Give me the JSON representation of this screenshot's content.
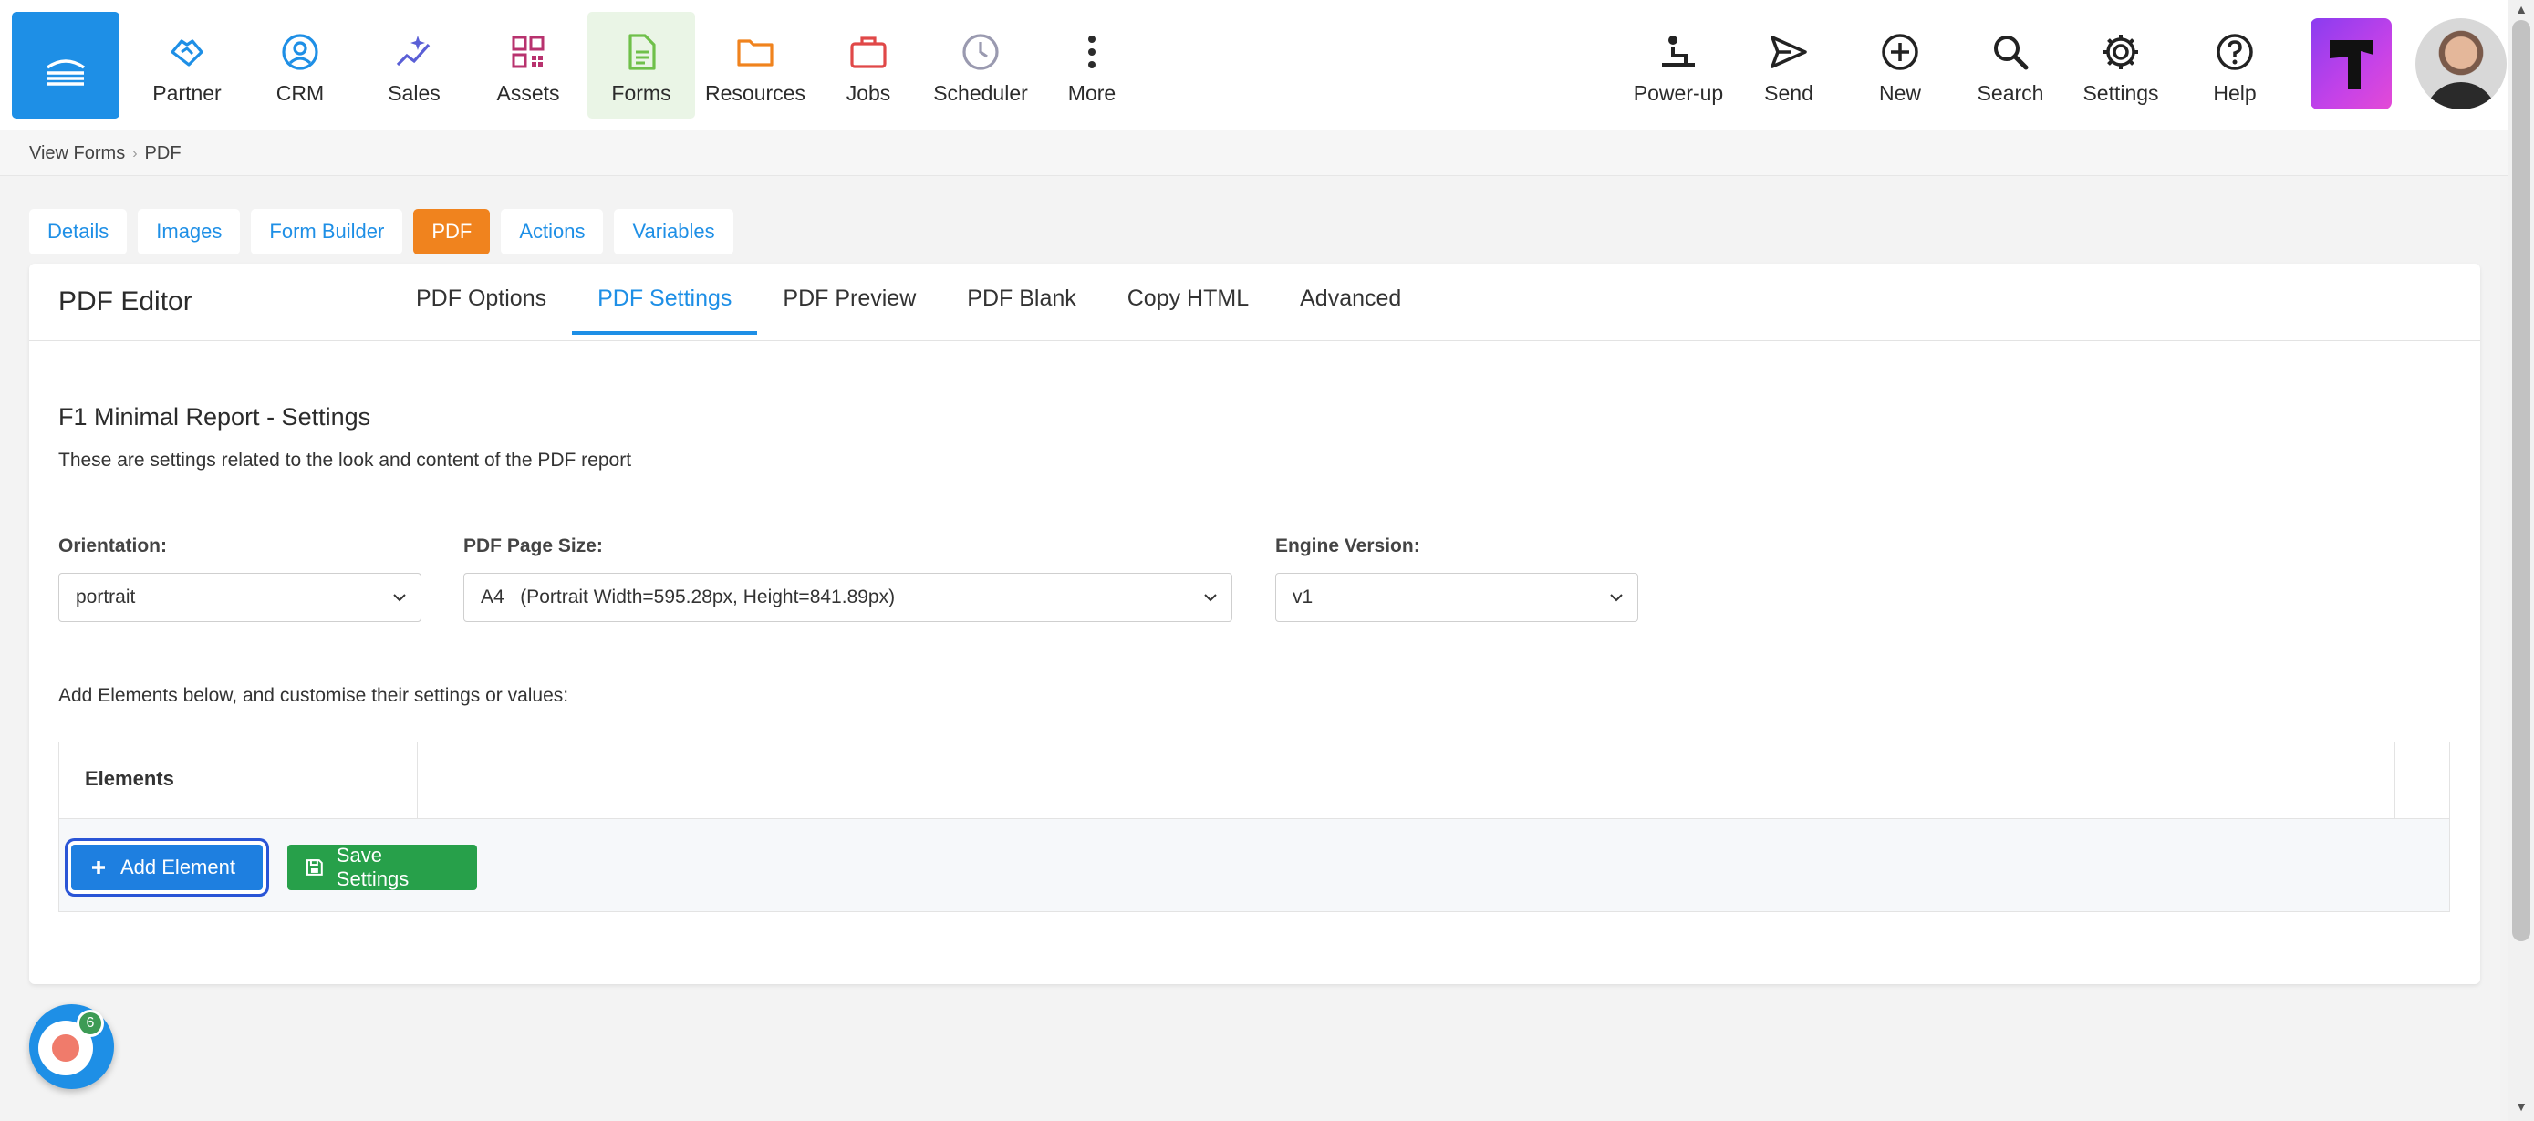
{
  "nav": {
    "items": [
      {
        "label": "Partner",
        "icon": "handshake-icon",
        "color": "#1e8fe6"
      },
      {
        "label": "CRM",
        "icon": "user-circle-icon",
        "color": "#1e8fe6"
      },
      {
        "label": "Sales",
        "icon": "sparkle-chart-icon",
        "color": "#5a5fd6"
      },
      {
        "label": "Assets",
        "icon": "qr-code-icon",
        "color": "#b8326e"
      },
      {
        "label": "Forms",
        "icon": "document-icon",
        "color": "#6fc04a"
      },
      {
        "label": "Resources",
        "icon": "folder-icon",
        "color": "#f0831e"
      },
      {
        "label": "Jobs",
        "icon": "briefcase-icon",
        "color": "#e04848"
      },
      {
        "label": "Scheduler",
        "icon": "clock-icon",
        "color": "#9a9ab0"
      },
      {
        "label": "More",
        "icon": "more-vertical-icon",
        "color": "#2b2b2b"
      }
    ],
    "right_items": [
      {
        "label": "Power-up",
        "icon": "person-lift-icon"
      },
      {
        "label": "Send",
        "icon": "send-icon"
      },
      {
        "label": "New",
        "icon": "plus-circle-icon"
      },
      {
        "label": "Search",
        "icon": "search-icon"
      },
      {
        "label": "Settings",
        "icon": "gear-icon"
      },
      {
        "label": "Help",
        "icon": "help-circle-icon"
      }
    ],
    "active": "Forms"
  },
  "breadcrumb": [
    "View Forms",
    "PDF"
  ],
  "main_tabs": [
    "Details",
    "Images",
    "Form Builder",
    "PDF",
    "Actions",
    "Variables"
  ],
  "main_tab_active": "PDF",
  "card": {
    "title": "PDF Editor",
    "subtabs": [
      "PDF Options",
      "PDF Settings",
      "PDF Preview",
      "PDF Blank",
      "Copy HTML",
      "Advanced"
    ],
    "subtab_active": "PDF Settings"
  },
  "section": {
    "title": "F1 Minimal Report - Settings",
    "description": "These are settings related to the look and content of the PDF report"
  },
  "fields": {
    "orientation": {
      "label": "Orientation:",
      "value": "portrait"
    },
    "page_size": {
      "label": "PDF Page Size:",
      "value": "A4   (Portrait Width=595.28px, Height=841.89px)"
    },
    "engine": {
      "label": "Engine Version:",
      "value": "v1"
    }
  },
  "elements": {
    "intro": "Add Elements below, and customise their settings or values:",
    "header": "Elements",
    "add_button": "Add Element",
    "save_button": "Save Settings"
  },
  "recorder_badge": "6",
  "colors": {
    "primary": "#1e8fe6",
    "pdf_tab": "#f0831e",
    "save_green": "#27a04a",
    "forms_active_bg": "#eaf5e6"
  }
}
